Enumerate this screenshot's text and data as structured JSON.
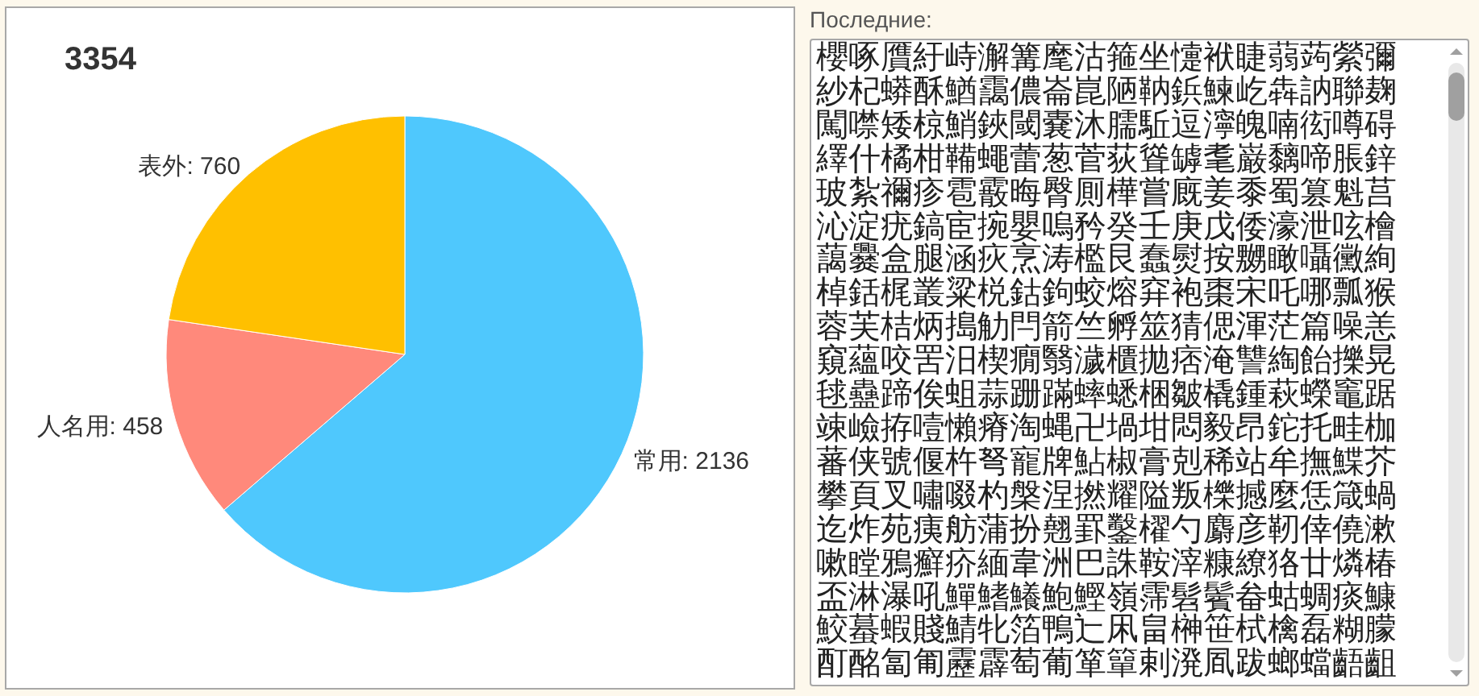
{
  "chart_panel": {
    "chart_data": {
      "type": "pie",
      "title": "3354",
      "values": [
        2136,
        458,
        760
      ],
      "colors": [
        "#4fc8fd",
        "#ff897b",
        "#ffc000"
      ],
      "value_labels": [
        "常用: 2136",
        "人名用: 458",
        "表外: 760"
      ]
    }
  },
  "recent": {
    "label": "Последние:",
    "lines": [
      "櫻啄贋紆峙澥篝麾沽箍坐懥袱睫蒻蒟縈彌",
      "紗杞蟒酥鰌靄儂崙崑陋靹鋲鰊屹犇訥聯麹",
      "闖噤矮椋鮹鋏閾嚢沐臑駈逗濘魄喃衒噂碍",
      "繹什橘柑鞴蠅蕾葱菅荻聳罅耄巌黐啼脹鋅",
      "玻紮禰疹雹霰晦臀厠樺嘗廐姜黍蜀篡魁莒",
      "沁淀疣鎬宦捥嬰嗚矜癸壬庚戊倭濠泄呟檜",
      "藹爨盒腿涵疢烹涛檻艮蠢熨按嬲瞰囁黴絢",
      "棹銛梶叢粱棁鈷鉤蛟熔穽袍棗宋吒哪瓢猴",
      "蓉芙桔炳搗觔閂箭竺孵筮猜偲渾茫篇噪恙",
      "窺蘊咬罟汨楔癇翳濊櫃拋痞淹讐綯飴擽晃",
      "毬蠱蹄俟蛆蒜跚蹣蟀蟋梱皺橇鍾萩蠑竈踞",
      "竦嶮拵噎懶瘠淘蝿卍堝坩悶毅昂鉈托畦枷",
      "蕃侠號偃杵弩寵牌鮎椒膏剋稀站牟撫鰈芥",
      "攀頁叉嘯啜杓槃涅撚耀隘叛櫟撼麼恁箴蝸",
      "迄炸苑痍舫蒲扮翹罫鑿櫂勺麝彦靭倖僥漱",
      "嗽瞠鴉癬疥緬韋洲巴誅鞍滓糠繚狢廿燐椿",
      "盃淋瀑吼鱓鰭鱶鮑鰹嶺霈髫鬢畚蛄蜩痰鱇",
      "鮫蟇蝦賤鯖牝箔鴨辷凩畠榊笹栻檎磊糊朦",
      "酊酩匐匍靂霹萄葡箪簞剌溌凮跋螂蟷齬齟"
    ]
  }
}
